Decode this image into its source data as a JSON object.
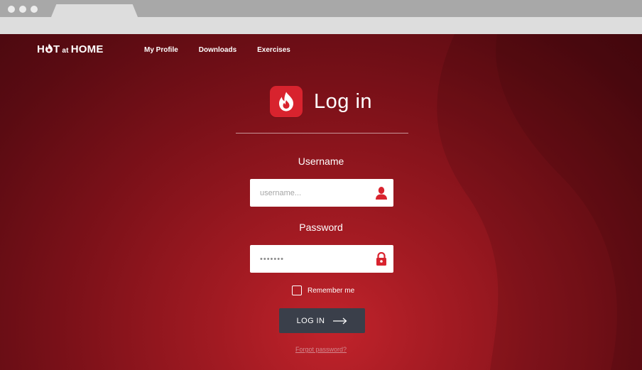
{
  "nav": {
    "logo_prefix": "H",
    "logo_after_o": "T",
    "logo_small": "at",
    "logo_suffix": "HOME",
    "links": [
      "My Profile",
      "Downloads",
      "Exercises"
    ]
  },
  "login": {
    "icon": "flame-icon",
    "title": "Log in",
    "username_label": "Username",
    "username_placeholder": "username...",
    "username_icon": "user-icon",
    "password_label": "Password",
    "password_value": "•••••••",
    "password_icon": "lock-icon",
    "remember_label": "Remember me",
    "remember_checked": false,
    "button_label": "LOG IN",
    "button_icon": "arrow-right-icon",
    "forgot_label": "Forgot password?"
  },
  "colors": {
    "accent": "#d8232e",
    "background_dark": "#5a0b12",
    "background_light": "#c1232b",
    "button": "#3a3f4a"
  }
}
